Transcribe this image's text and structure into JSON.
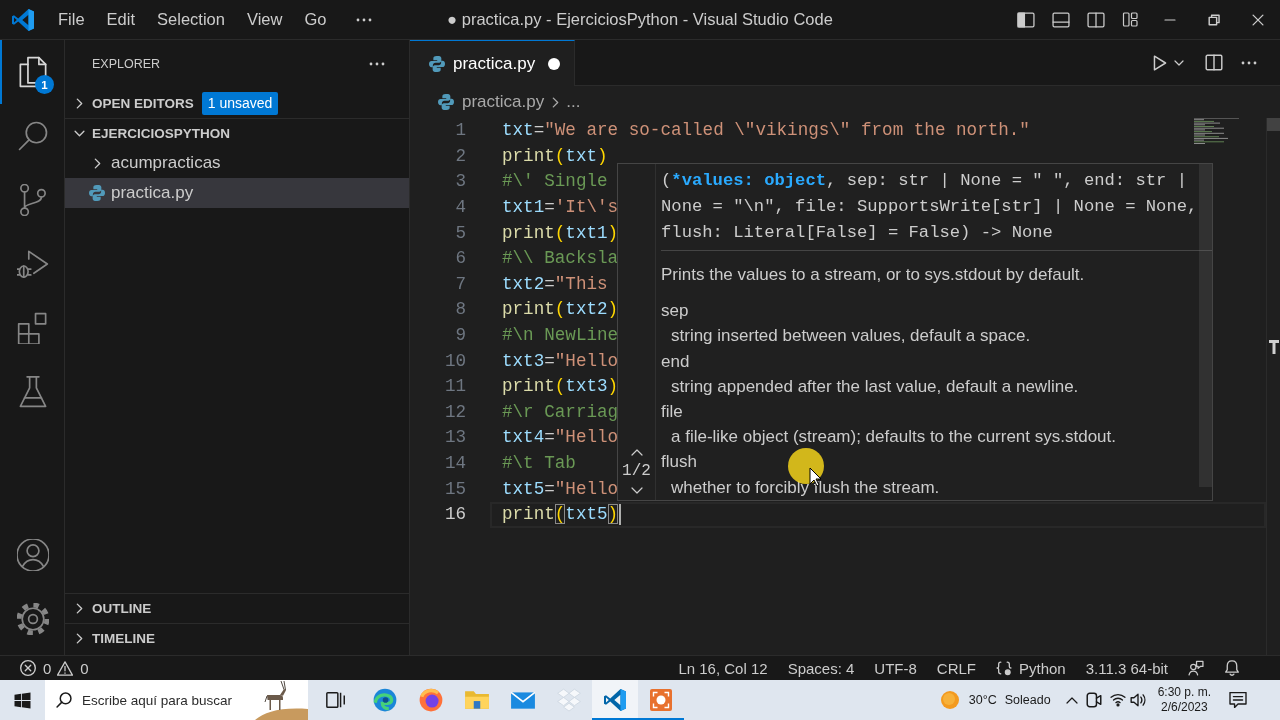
{
  "title_bar": {
    "menu": [
      "File",
      "Edit",
      "Selection",
      "View",
      "Go"
    ],
    "title": "● practica.py - EjerciciosPython - Visual Studio Code",
    "layout_toggles": [
      {
        "kind": "sidebar",
        "on": true
      },
      {
        "kind": "panel",
        "on": false
      },
      {
        "kind": "auxiliary",
        "on": false
      }
    ]
  },
  "activity_bar": {
    "items": [
      {
        "kind": "explorer",
        "selected": true,
        "badge": "1"
      },
      {
        "kind": "search",
        "selected": false
      },
      {
        "kind": "scm",
        "selected": false
      },
      {
        "kind": "debug",
        "selected": false
      },
      {
        "kind": "extensions",
        "selected": false
      },
      {
        "kind": "testing",
        "selected": false
      }
    ],
    "bottom_items": [
      {
        "kind": "accounts"
      },
      {
        "kind": "settings"
      }
    ]
  },
  "sidebar": {
    "title": "EXPLORER",
    "open_editors": {
      "label": "OPEN EDITORS",
      "expanded": false,
      "badge": "1 unsaved"
    },
    "workspace": {
      "label": "EJERCICIOSPYTHON",
      "expanded": true,
      "items": [
        {
          "kind": "folder",
          "label": "acumpracticas",
          "expanded": false,
          "selected": false
        },
        {
          "kind": "file",
          "label": "practica.py",
          "selected": true
        }
      ]
    },
    "bottom_sections": [
      {
        "label": "OUTLINE",
        "expanded": false
      },
      {
        "label": "TIMELINE",
        "expanded": false
      }
    ]
  },
  "editor": {
    "tabs": [
      {
        "label": "practica.py",
        "selected": true,
        "unsaved": true
      }
    ],
    "breadcrumb": {
      "file": "practica.py",
      "more": "..."
    },
    "lines": [
      {
        "number": "1",
        "current": false,
        "tokens": [
          {
            "kind": "var",
            "text": "txt"
          },
          {
            "kind": "op",
            "text": "="
          },
          {
            "kind": "str",
            "text": "\"We are so-called \\\"vikings\\\" from the north.\""
          }
        ]
      },
      {
        "number": "2",
        "current": false,
        "tokens": [
          {
            "kind": "fn",
            "text": "print"
          },
          {
            "kind": "paren",
            "text": "("
          },
          {
            "kind": "var",
            "text": "txt"
          },
          {
            "kind": "paren",
            "text": ")"
          }
        ]
      },
      {
        "number": "3",
        "current": false,
        "tokens": [
          {
            "kind": "comment",
            "text": "#\\' Single"
          }
        ]
      },
      {
        "number": "4",
        "current": false,
        "tokens": [
          {
            "kind": "var",
            "text": "txt1"
          },
          {
            "kind": "op",
            "text": "="
          },
          {
            "kind": "str",
            "text": "'It\\'s"
          }
        ]
      },
      {
        "number": "5",
        "current": false,
        "tokens": [
          {
            "kind": "fn",
            "text": "print"
          },
          {
            "kind": "paren",
            "text": "("
          },
          {
            "kind": "var",
            "text": "txt1"
          },
          {
            "kind": "paren",
            "text": ")"
          }
        ]
      },
      {
        "number": "6",
        "current": false,
        "tokens": [
          {
            "kind": "comment",
            "text": "#\\\\ Backsla"
          }
        ]
      },
      {
        "number": "7",
        "current": false,
        "tokens": [
          {
            "kind": "var",
            "text": "txt2"
          },
          {
            "kind": "op",
            "text": "="
          },
          {
            "kind": "str",
            "text": "\"This"
          }
        ]
      },
      {
        "number": "8",
        "current": false,
        "tokens": [
          {
            "kind": "fn",
            "text": "print"
          },
          {
            "kind": "paren",
            "text": "("
          },
          {
            "kind": "var",
            "text": "txt2"
          },
          {
            "kind": "paren",
            "text": ")"
          }
        ]
      },
      {
        "number": "9",
        "current": false,
        "tokens": [
          {
            "kind": "comment",
            "text": "#\\n NewLine"
          }
        ]
      },
      {
        "number": "10",
        "current": false,
        "tokens": [
          {
            "kind": "var",
            "text": "txt3"
          },
          {
            "kind": "op",
            "text": "="
          },
          {
            "kind": "str",
            "text": "\"Hello"
          }
        ]
      },
      {
        "number": "11",
        "current": false,
        "tokens": [
          {
            "kind": "fn",
            "text": "print"
          },
          {
            "kind": "paren",
            "text": "("
          },
          {
            "kind": "var",
            "text": "txt3"
          },
          {
            "kind": "paren",
            "text": ")"
          }
        ]
      },
      {
        "number": "12",
        "current": false,
        "tokens": [
          {
            "kind": "comment",
            "text": "#\\r Carriag"
          }
        ]
      },
      {
        "number": "13",
        "current": false,
        "tokens": [
          {
            "kind": "var",
            "text": "txt4"
          },
          {
            "kind": "op",
            "text": "="
          },
          {
            "kind": "str",
            "text": "\"Hello"
          }
        ]
      },
      {
        "number": "14",
        "current": false,
        "tokens": [
          {
            "kind": "comment",
            "text": "#\\t Tab"
          }
        ]
      },
      {
        "number": "15",
        "current": false,
        "tokens": [
          {
            "kind": "var",
            "text": "txt5"
          },
          {
            "kind": "op",
            "text": "="
          },
          {
            "kind": "str",
            "text": "\"Hello"
          }
        ]
      },
      {
        "number": "16",
        "current": true,
        "tokens": [
          {
            "kind": "fn",
            "text": "print"
          },
          {
            "kind": "match",
            "text": "("
          },
          {
            "kind": "var",
            "text": "txt5"
          },
          {
            "kind": "match",
            "text": ")"
          }
        ]
      }
    ],
    "hover": {
      "overload": "1/2",
      "signature": {
        "open": "(",
        "active": "*values: object",
        "rest": ", sep: str | None = \" \", end: str | None = \"\\n\", file: SupportsWrite[str] | None = None, flush: Literal[False] = False) -> None"
      },
      "summary": "Prints the values to a stream, or to sys.stdout by default.",
      "params": [
        {
          "name": "sep",
          "doc": "string inserted between values, default a space."
        },
        {
          "name": "end",
          "doc": "string appended after the last value, default a newline."
        },
        {
          "name": "file",
          "doc": "a file-like object (stream); defaults to the current sys.stdout."
        },
        {
          "name": "flush",
          "doc": "whether to forcibly flush the stream."
        }
      ]
    }
  },
  "status_bar": {
    "errors": "0",
    "warnings": "0",
    "items": [
      {
        "kind": "text",
        "label": "Ln 16, Col 12"
      },
      {
        "kind": "text",
        "label": "Spaces: 4"
      },
      {
        "kind": "text",
        "label": "UTF-8"
      },
      {
        "kind": "text",
        "label": "CRLF"
      },
      {
        "kind": "language",
        "label": "Python"
      },
      {
        "kind": "text",
        "label": "3.11.3 64-bit"
      },
      {
        "kind": "feedback"
      },
      {
        "kind": "notifications"
      }
    ]
  },
  "taskbar": {
    "search": {
      "placeholder": "Escribe aquí para buscar"
    },
    "apps": [
      {
        "kind": "taskview",
        "running": false,
        "selected": false
      },
      {
        "kind": "edge",
        "running": false,
        "selected": false
      },
      {
        "kind": "firefox",
        "running": false,
        "selected": false
      },
      {
        "kind": "files",
        "running": false,
        "selected": false
      },
      {
        "kind": "mail",
        "running": false,
        "selected": false
      },
      {
        "kind": "dropbox",
        "running": false,
        "selected": false
      },
      {
        "kind": "vscode",
        "running": true,
        "selected": true
      },
      {
        "kind": "recorder",
        "running": true,
        "selected": false
      }
    ],
    "weather": {
      "temperature": "30°C",
      "condition": "Soleado"
    },
    "clock": {
      "time": "6:30 p. m.",
      "date": "2/6/2023"
    }
  }
}
